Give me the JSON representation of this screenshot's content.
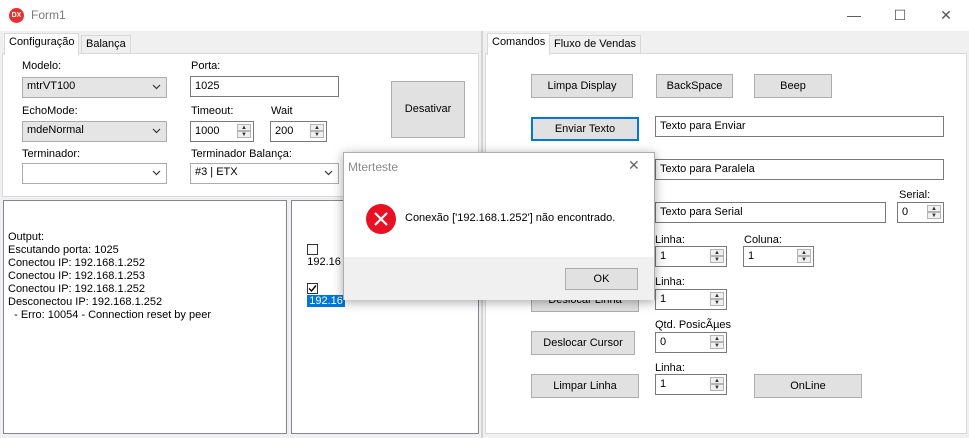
{
  "window": {
    "title": "Form1",
    "app_icon_text": "DX",
    "minimize_glyph": "—",
    "maximize_glyph": "☐",
    "close_glyph": "✕"
  },
  "left_tabs": [
    "Configuração",
    "Balança"
  ],
  "config": {
    "modelo_label": "Modelo:",
    "modelo_value": "mtrVT100",
    "porta_label": "Porta:",
    "porta_value": "1025",
    "echomode_label": "EchoMode:",
    "echomode_value": "mdeNormal",
    "timeout_label": "Timeout:",
    "timeout_value": "1000",
    "wait_label": "Wait",
    "wait_value": "200",
    "terminador_label": "Terminador:",
    "terminador_value": "",
    "term_balanca_label": "Terminador Balança:",
    "term_balanca_value": "#3 | ETX",
    "desativar_label": "Desativar"
  },
  "output": {
    "lines": [
      "Output:",
      "",
      "Escutando porta: 1025",
      "Conectou IP: 192.168.1.252",
      "Conectou IP: 192.168.1.253",
      "Conectou IP: 192.168.1.252",
      "Desconectou IP: 192.168.1.252",
      "  - Erro: 10054 - Connection reset by peer"
    ]
  },
  "ip_list": {
    "items": [
      {
        "text": "192.16",
        "checked": false,
        "selected": false
      },
      {
        "text": "192.16",
        "checked": true,
        "selected": true
      }
    ]
  },
  "right_tabs": [
    "Comandos",
    "Fluxo de Vendas"
  ],
  "comandos": {
    "limpa_display": "Limpa Display",
    "backspace": "BackSpace",
    "beep": "Beep",
    "enviar_texto": "Enviar Texto",
    "texto_enviar": "Texto para Enviar",
    "texto_paralela": "Texto para Paralela",
    "texto_serial": "Texto para Serial",
    "serial_label": "Serial:",
    "serial_value": "0",
    "linha_label": "Linha:",
    "linha1_value": "1",
    "coluna_label": "Coluna:",
    "coluna_value": "1",
    "deslocar_linha": "Deslocar Linha",
    "linha2_value": "1",
    "qtd_posicoes_label": "Qtd. PosicÃµes",
    "qtd_value": "0",
    "deslocar_cursor": "Deslocar Cursor",
    "limpar_linha": "Limpar Linha",
    "linha3_value": "1",
    "online": "OnLine"
  },
  "dialog": {
    "title": "Mterteste",
    "message": "Conexão ['192.168.1.252'] não encontrado.",
    "ok_label": "OK",
    "close_glyph": "✕"
  },
  "colors": {
    "error_red": "#e81123",
    "selection_blue": "#0078d7",
    "app_icon_red": "#e8312f"
  }
}
